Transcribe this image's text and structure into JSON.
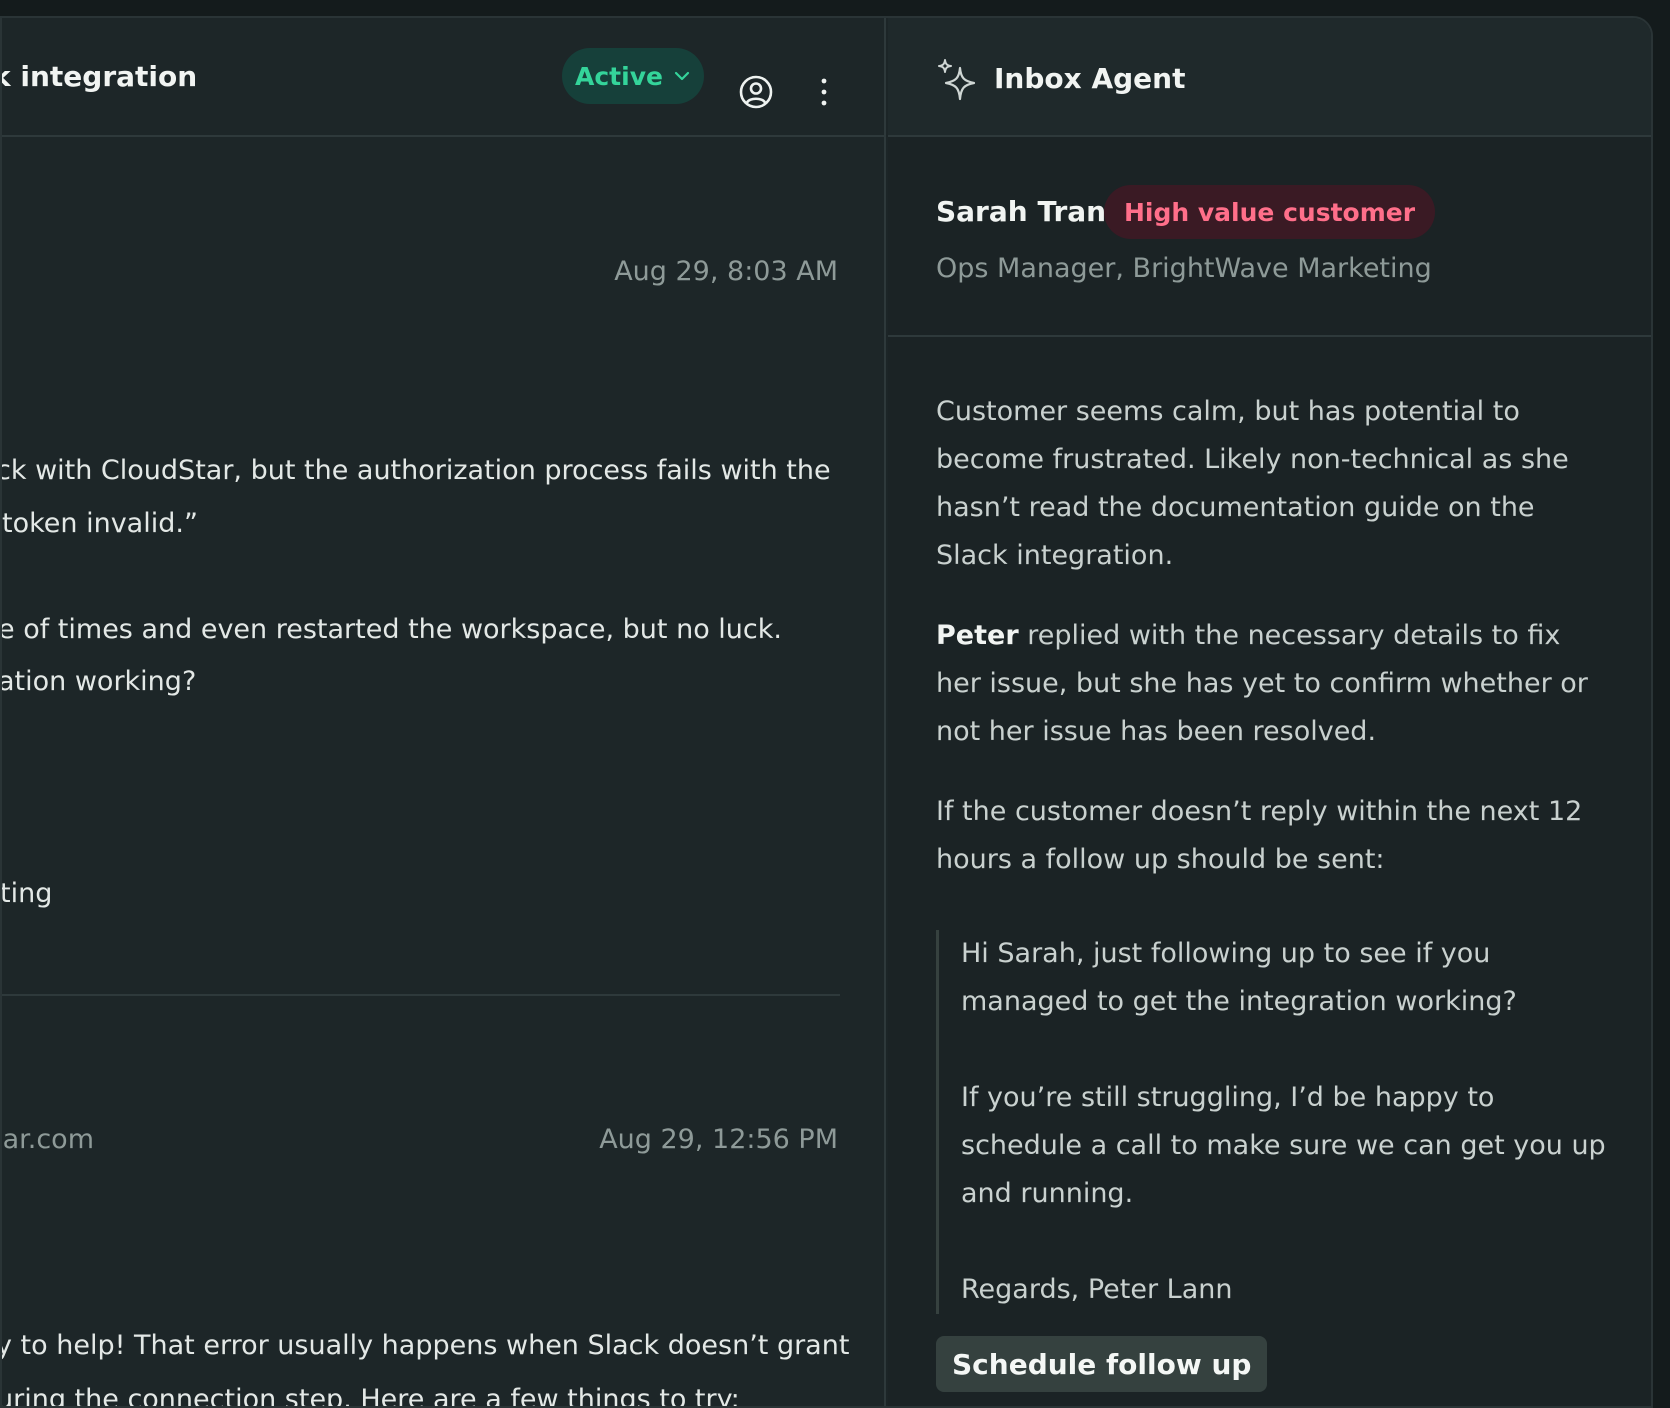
{
  "conversation": {
    "title": "k integration",
    "status_label": "Active",
    "messages": [
      {
        "timestamp": "Aug 29, 8:03 AM",
        "lines": [
          "ck with CloudStar, but the authorization process fails with the",
          "token invalid.”",
          "e of times and even restarted the workspace, but no luck.",
          "ation working?"
        ],
        "signature": "ting"
      },
      {
        "sender_email": "tar.com",
        "timestamp": "Aug 29, 12:56 PM",
        "lines": [
          "y to help! That error usually happens when Slack doesn’t grant",
          "uring the connection step. Here are a few things to try:"
        ]
      }
    ]
  },
  "agent_panel": {
    "title": "Inbox Agent",
    "customer": {
      "name": "Sarah Tran",
      "badge": "High value customer",
      "role": "Ops Manager, BrightWave Marketing"
    },
    "summary": {
      "p1": "Customer seems calm, but has potential to become frustrated. Likely non-technical as she hasn’t read the documentation guide on the Slack integration.",
      "p2_name": "Peter",
      "p2_rest": " replied with the necessary details to fix her issue, but she has yet to confirm whether or not her issue has been resolved.",
      "p3": "If the customer doesn’t reply within the next 12 hours a follow up should be sent:"
    },
    "draft": {
      "p1": "Hi Sarah, just following up to see if you managed to get the integration working?",
      "p2": "If you’re still struggling, I’d be happy to schedule a call to make sure we can get you up and running.",
      "p3": "Regards, Peter Lann"
    },
    "action_label": "Schedule follow up"
  },
  "colors": {
    "status_accent": "#34d49a",
    "badge_text": "#ff6f8a",
    "badge_bg": "#3a1a24"
  }
}
